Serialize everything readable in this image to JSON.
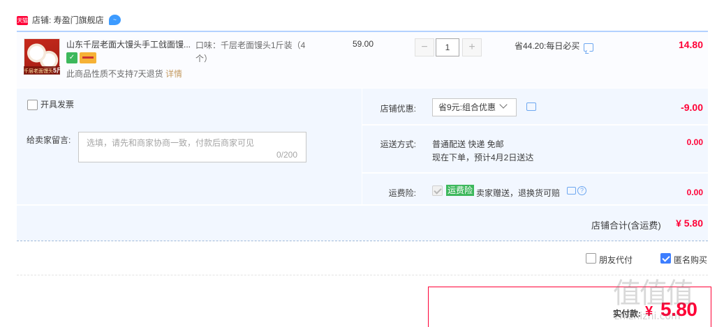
{
  "store": {
    "badge": "天猫",
    "name": "店铺: 寿盈门旗舰店",
    "chat_glyph": "~"
  },
  "product": {
    "title": "山东千层老面大馒头手工戗面馒...",
    "thumb_caption": "千层老面馒头",
    "thumb_caption_big": "5斤",
    "no_return_text": "此商品性质不支持7天退货",
    "no_return_link": "详情",
    "sku": "口味：千层老面馒头1斤装（4个）",
    "unit_price": "59.00",
    "quantity": "1",
    "qty_minus": "−",
    "qty_plus": "+",
    "promo": "省44.20:每日必买",
    "line_total": "14.80"
  },
  "options": {
    "invoice_label": "开具发票",
    "message_label": "给卖家留言:",
    "message_placeholder": "选填，请先和商家协商一致，付款后商家可见",
    "message_count": "0/200",
    "discount_label": "店铺优惠:",
    "discount_value": "省9元:组合优惠",
    "discount_amount": "-9.00",
    "shipping_label": "运送方式:",
    "shipping_method": "普通配送 快递 免邮",
    "shipping_eta": "现在下单，预计4月2日送达",
    "shipping_amount": "0.00",
    "insurance_label": "运费险:",
    "insurance_badge": "运费险",
    "insurance_text": "卖家赠送，退换货可赔",
    "insurance_help": "?",
    "insurance_amount": "0.00",
    "shop_total_label": "店铺合计(含运费)",
    "shop_total_value": "¥ 5.80"
  },
  "footer": {
    "friend_pay_label": "朋友代付",
    "anonymous_label": "匿名购买",
    "anonymous_checked": true,
    "pay_label": "实付款:",
    "pay_currency": "¥",
    "pay_value": "5.80"
  },
  "watermark": {
    "text": "值值值",
    "url": "zhizhizhi.com"
  },
  "colors": {
    "accent_red": "#ff0036",
    "accent_blue": "#3d7eff",
    "panel_bg": "#f2f7ff"
  }
}
